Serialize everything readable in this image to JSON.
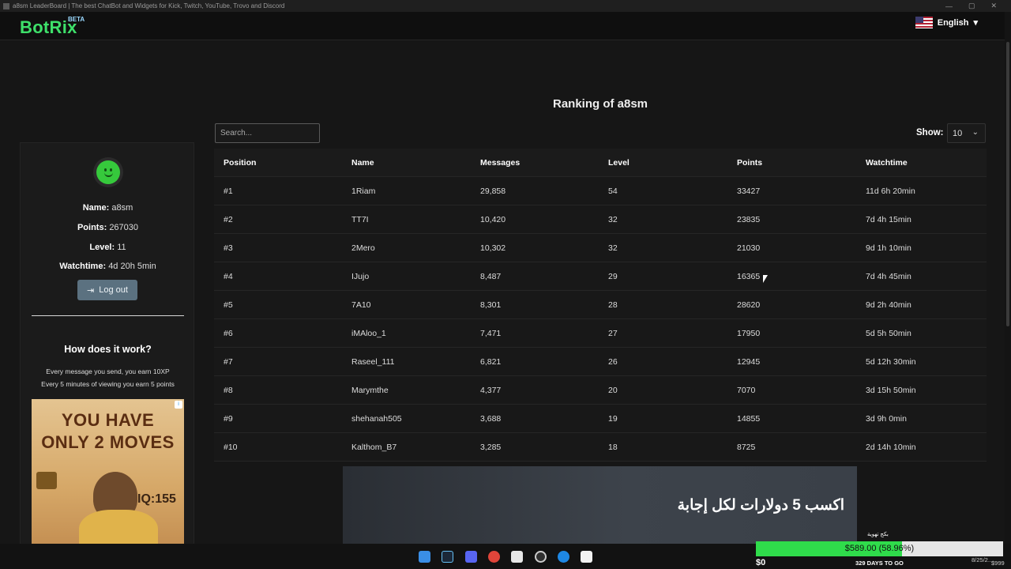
{
  "window": {
    "title": "a8sm LeaderBoard | The best ChatBot and Widgets for Kick, Twitch, YouTube, Trovo and Discord"
  },
  "navbar": {
    "brand": "BotRix",
    "badge": "BETA",
    "language": "English",
    "language_flag_icon": "us-flag-icon"
  },
  "page": {
    "title": "Ranking of a8sm"
  },
  "profile": {
    "name_label": "Name:",
    "name": "a8sm",
    "points_label": "Points:",
    "points": "267030",
    "level_label": "Level:",
    "level": "11",
    "watchtime_label": "Watchtime:",
    "watchtime": "4d 20h 5min",
    "logout_label": "Log out"
  },
  "how": {
    "title": "How does it work?",
    "line1": "Every message you send, you earn 10XP",
    "line2": "Every 5 minutes of viewing you earn 5 points"
  },
  "ad": {
    "line1": "YOU HAVE",
    "line2": "ONLY 2 MOVES",
    "iq": "IQ:155"
  },
  "controls": {
    "search_placeholder": "Search...",
    "show_label": "Show:",
    "show_value": "10"
  },
  "table": {
    "headers": [
      "Position",
      "Name",
      "Messages",
      "Level",
      "Points",
      "Watchtime"
    ],
    "rows": [
      [
        "#1",
        "1Riam",
        "29,858",
        "54",
        "33427",
        "11d 6h 20min"
      ],
      [
        "#2",
        "TT7I",
        "10,420",
        "32",
        "23835",
        "7d 4h 15min"
      ],
      [
        "#3",
        "2Mero",
        "10,302",
        "32",
        "21030",
        "9d 1h 10min"
      ],
      [
        "#4",
        "IJujo",
        "8,487",
        "29",
        "16365",
        "7d 4h 45min"
      ],
      [
        "#5",
        "7A10",
        "8,301",
        "28",
        "28620",
        "9d 2h 40min"
      ],
      [
        "#6",
        "iMAloo_1",
        "7,471",
        "27",
        "17950",
        "5d 5h 50min"
      ],
      [
        "#7",
        "Raseel_111",
        "6,821",
        "26",
        "12945",
        "5d 12h 30min"
      ],
      [
        "#8",
        "Marymthe",
        "4,377",
        "20",
        "7070",
        "3d 15h 50min"
      ],
      [
        "#9",
        "shehanah505",
        "3,688",
        "19",
        "14855",
        "3d 9h 0min"
      ],
      [
        "#10",
        "Kalthom_B7",
        "3,285",
        "18",
        "8725",
        "2d 14h 10min"
      ]
    ]
  },
  "video_ad": {
    "text": "اكسب 5 دولارات لكل إجابة"
  },
  "taskbar_widget": {
    "label": "بكج تهوية",
    "progress_text": "$589.00 (58.96%)",
    "progress_fraction": 0.5896,
    "start": "$0",
    "days": "329 DAYS TO GO",
    "date": "8/25/2...",
    "goal": "$999"
  },
  "taskbar_icons": [
    "windows-start-icon",
    "steam-icon",
    "discord-icon",
    "chrome-icon",
    "app-icon",
    "obs-icon",
    "edge-icon",
    "capcut-icon"
  ]
}
